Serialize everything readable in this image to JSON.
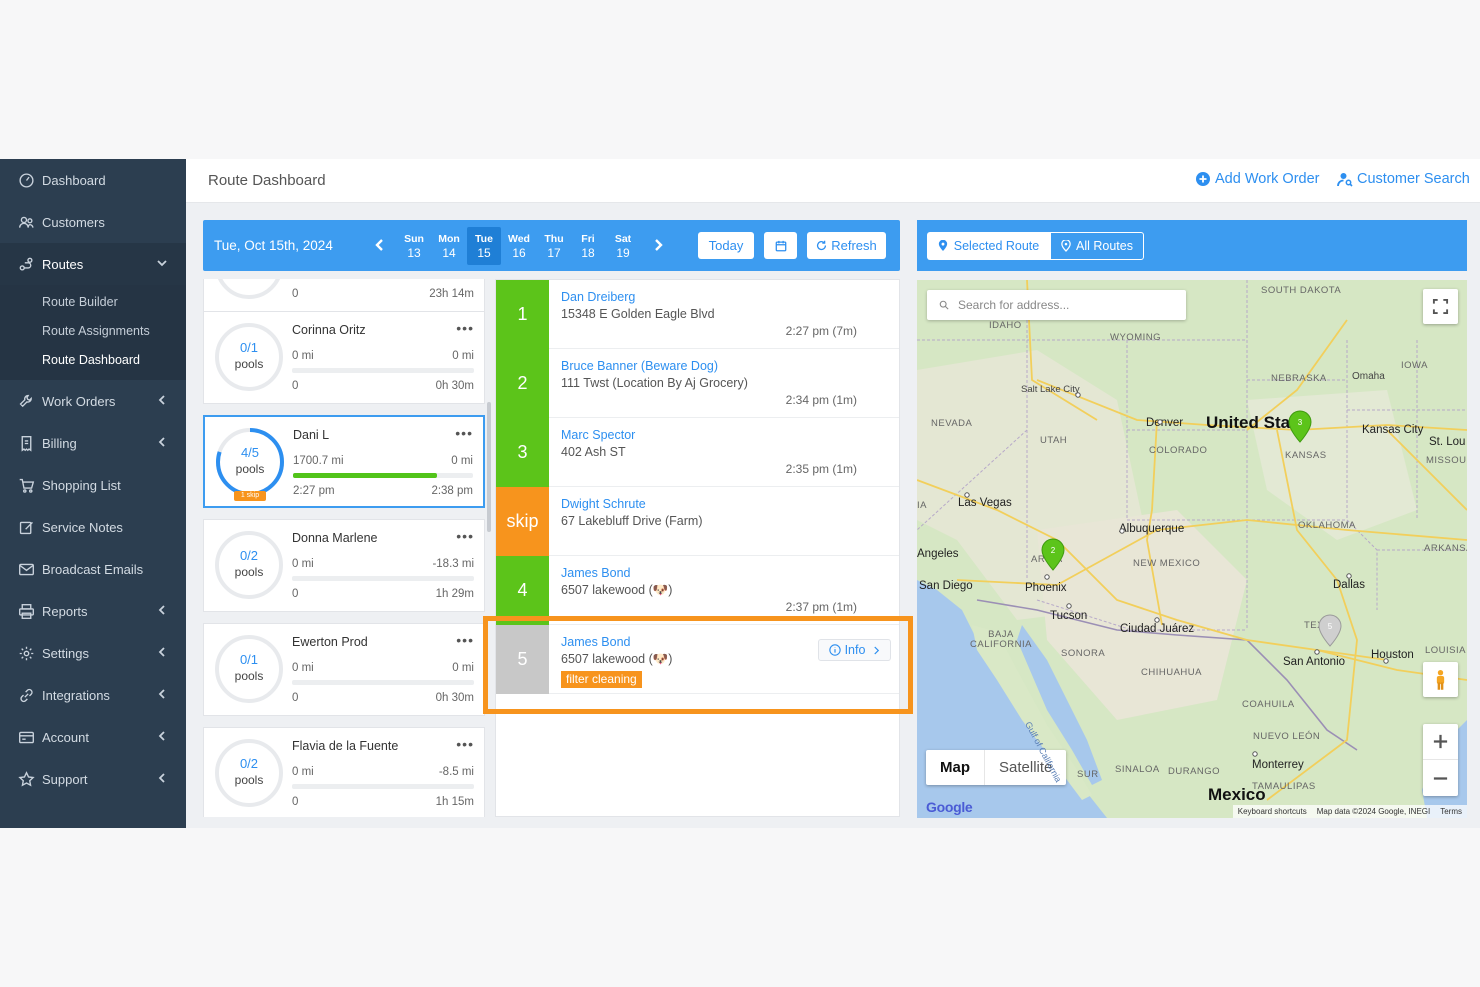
{
  "sidebar": {
    "items": [
      {
        "label": "Dashboard",
        "icon": "dashboard-icon"
      },
      {
        "label": "Customers",
        "icon": "customers-icon"
      },
      {
        "label": "Routes",
        "icon": "routes-icon"
      },
      {
        "label": "Work Orders",
        "icon": "work-orders-icon"
      },
      {
        "label": "Billing",
        "icon": "billing-icon"
      },
      {
        "label": "Shopping List",
        "icon": "cart-icon"
      },
      {
        "label": "Service Notes",
        "icon": "notes-icon"
      },
      {
        "label": "Broadcast Emails",
        "icon": "email-icon"
      },
      {
        "label": "Reports",
        "icon": "printer-icon"
      },
      {
        "label": "Settings",
        "icon": "gear-icon"
      },
      {
        "label": "Integrations",
        "icon": "link-icon"
      },
      {
        "label": "Account",
        "icon": "card-icon"
      },
      {
        "label": "Support",
        "icon": "star-icon"
      }
    ],
    "routes_submenu": [
      "Route Builder",
      "Route Assignments",
      "Route Dashboard"
    ]
  },
  "header": {
    "title": "Route Dashboard",
    "add_work_order": "Add Work Order",
    "customer_search": "Customer Search"
  },
  "toolbar": {
    "date": "Tue, Oct 15th, 2024",
    "days": [
      {
        "d": "Sun",
        "n": "13"
      },
      {
        "d": "Mon",
        "n": "14"
      },
      {
        "d": "Tue",
        "n": "15"
      },
      {
        "d": "Wed",
        "n": "16"
      },
      {
        "d": "Thu",
        "n": "17"
      },
      {
        "d": "Fri",
        "n": "18"
      },
      {
        "d": "Sat",
        "n": "19"
      }
    ],
    "today": "Today",
    "refresh": "Refresh"
  },
  "drivers": {
    "partial_top": {
      "left": "0",
      "right": "23h 14m"
    },
    "cards": [
      {
        "name": "Corinna Oritz",
        "count": "0/1",
        "unit": "pools",
        "mi_left": "0 mi",
        "mi_right": "0 mi",
        "bottom_left": "0",
        "bottom_right": "0h 30m",
        "progress": 0
      },
      {
        "name": "Dani L",
        "count": "4/5",
        "unit": "pools",
        "mi_left": "1700.7 mi",
        "mi_right": "0 mi",
        "bottom_left": "2:27 pm",
        "bottom_right": "2:38 pm",
        "progress": 0.8,
        "badge": "1 skip"
      },
      {
        "name": "Donna Marlene",
        "count": "0/2",
        "unit": "pools",
        "mi_left": "0 mi",
        "mi_right": "-18.3 mi",
        "bottom_left": "0",
        "bottom_right": "1h 29m",
        "progress": 0
      },
      {
        "name": "Ewerton Prod",
        "count": "0/1",
        "unit": "pools",
        "mi_left": "0 mi",
        "mi_right": "0 mi",
        "bottom_left": "0",
        "bottom_right": "0h 30m",
        "progress": 0
      },
      {
        "name": "Flavia de la Fuente",
        "count": "0/2",
        "unit": "pools",
        "mi_left": "0 mi",
        "mi_right": "-8.5 mi",
        "bottom_left": "0",
        "bottom_right": "1h 15m",
        "progress": 0
      }
    ]
  },
  "stops": [
    {
      "num": "1",
      "name": "Dan Dreiberg",
      "address": "15348 E Golden Eagle Blvd",
      "time": "2:27 pm (7m)",
      "status": "done"
    },
    {
      "num": "2",
      "name": "Bruce Banner (Beware Dog)",
      "address": "111 Twst (Location By Aj Grocery)",
      "time": "2:34 pm (1m)",
      "status": "done"
    },
    {
      "num": "3",
      "name": "Marc Spector",
      "address": "402 Ash ST",
      "time": "2:35 pm (1m)",
      "status": "done"
    },
    {
      "num": "skip",
      "name": "Dwight Schrute",
      "address": "67 Lakebluff Drive (Farm)",
      "time": "",
      "status": "skip"
    },
    {
      "num": "4",
      "name": "James Bond",
      "address": "6507 lakewood (🐶)",
      "time": "2:37 pm (1m)",
      "status": "done"
    },
    {
      "num": "5",
      "name": "James Bond",
      "address": "6507 lakewood (🐶)",
      "time": "",
      "status": "pending",
      "tag": "filter cleaning",
      "info": "Info"
    }
  ],
  "colors": {
    "done": "#5cc41a",
    "skip": "#f7941d",
    "pending": "#c8c8c8",
    "accent": "#3d9cf0"
  },
  "map": {
    "selected_route": "Selected Route",
    "all_routes": "All Routes",
    "search_placeholder": "Search for address...",
    "map_btn": "Map",
    "satellite_btn": "Satellite",
    "labels": {
      "south_dakota": "SOUTH DAKOTA",
      "idaho": "IDAHO",
      "wyoming": "WYOMING",
      "iowa": "IOWA",
      "nebraska": "NEBRASKA",
      "omaha": "Omaha",
      "salt_lake": "Salt Lake City",
      "nevada": "NEVADA",
      "utah": "UTAH",
      "denver": "Denver",
      "united_states": "United Sta",
      "kansas_city": "Kansas City",
      "st_louis": "St. Lou",
      "colorado": "COLORADO",
      "kansas": "KANSAS",
      "missouri": "MISSOURI",
      "las_vegas": "Las Vegas",
      "ia": "IA",
      "albuquerque": "Albuquerque",
      "oklahoma": "OKLAHOMA",
      "angeles": "Angeles",
      "arizona": "AR NA",
      "new_mexico": "NEW MEXICO",
      "arkansas": "ARKANSAS",
      "san_diego": "San Diego",
      "phoenix": "Phoenix",
      "dallas": "Dallas",
      "tucson": "Tucson",
      "ciudad_juarez": "Ciudad Juárez",
      "texas": "TEXA",
      "baja": "BAJA",
      "california": "CALIFORNIA",
      "sonora": "SONORA",
      "louisiana": "LOUISIA",
      "chihuahua": "CHIHUAHUA",
      "san_antonio": "San Antonio",
      "houston": "Houston",
      "coahuila": "COAHUILA",
      "gulf": "Gulf of California",
      "nuevo_leon": "NUEVO LEÓN",
      "sinaloa": "SINALOA",
      "durango": "DURANGO",
      "monterrey": "Monterrey",
      "sur": "SUR",
      "tamaulipas": "TAMAULIPAS",
      "mexico": "Mexico"
    },
    "pins": [
      "3",
      "2",
      "5"
    ],
    "google": "Google",
    "keyboard": "Keyboard shortcuts",
    "map_data": "Map data ©2024 Google, INEGI",
    "terms": "Terms"
  }
}
